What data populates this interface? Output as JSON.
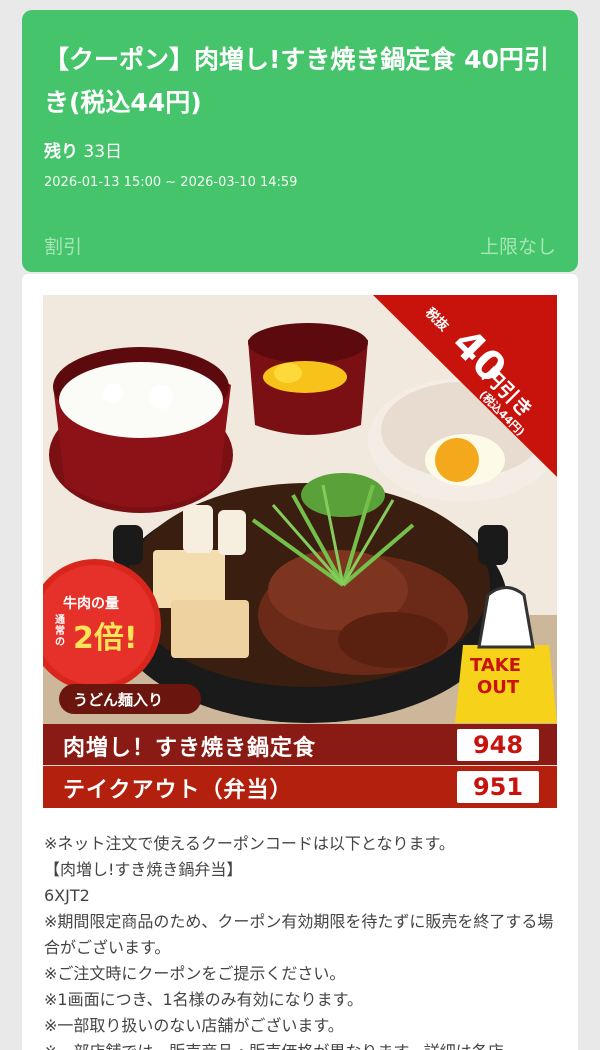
{
  "coupon": {
    "title": "【クーポン】肉増し!すき焼き鍋定食 40円引き(税込44円)",
    "remaining_label": "残り",
    "remaining_value": "33日",
    "period": "2026-01-13 15:00 ~ 2026-03-10 14:59",
    "discount_type": "割引",
    "limit": "上限なし"
  },
  "promo": {
    "badge_top": "税抜",
    "badge_amount": "40",
    "badge_unit": "円引き",
    "badge_tax": "(税込44円)",
    "beef_label_1": "牛肉の量",
    "beef_label_2": "通常の",
    "beef_label_3": "2倍!",
    "udon_label": "うどん麺入り",
    "takeout_1": "TAKE",
    "takeout_2": "OUT",
    "items": [
      {
        "name": "肉増し！すき焼き鍋定食",
        "price": "948"
      },
      {
        "name": "テイクアウト（弁当）",
        "price": "951"
      }
    ]
  },
  "notes": [
    "※ネット注文で使えるクーポンコードは以下となります。",
    "【肉増し!すき焼き鍋弁当】",
    "6XJT2",
    "※期間限定商品のため、クーポン有効期限を待たずに販売を終了する場合がございます。",
    "※ご注文時にクーポンをご提示ください。",
    "※1画面につき、1名様のみ有効になります。",
    "※一部取り扱いのない店舗がございます。",
    "※一部店舗では、販売商品・販売価格が異なります。詳細は各店"
  ],
  "colors": {
    "header_green": "#45c46b",
    "menu_bar_dark": "#8a1a14",
    "menu_bar_red": "#b3200e",
    "price_red": "#c8130c"
  }
}
